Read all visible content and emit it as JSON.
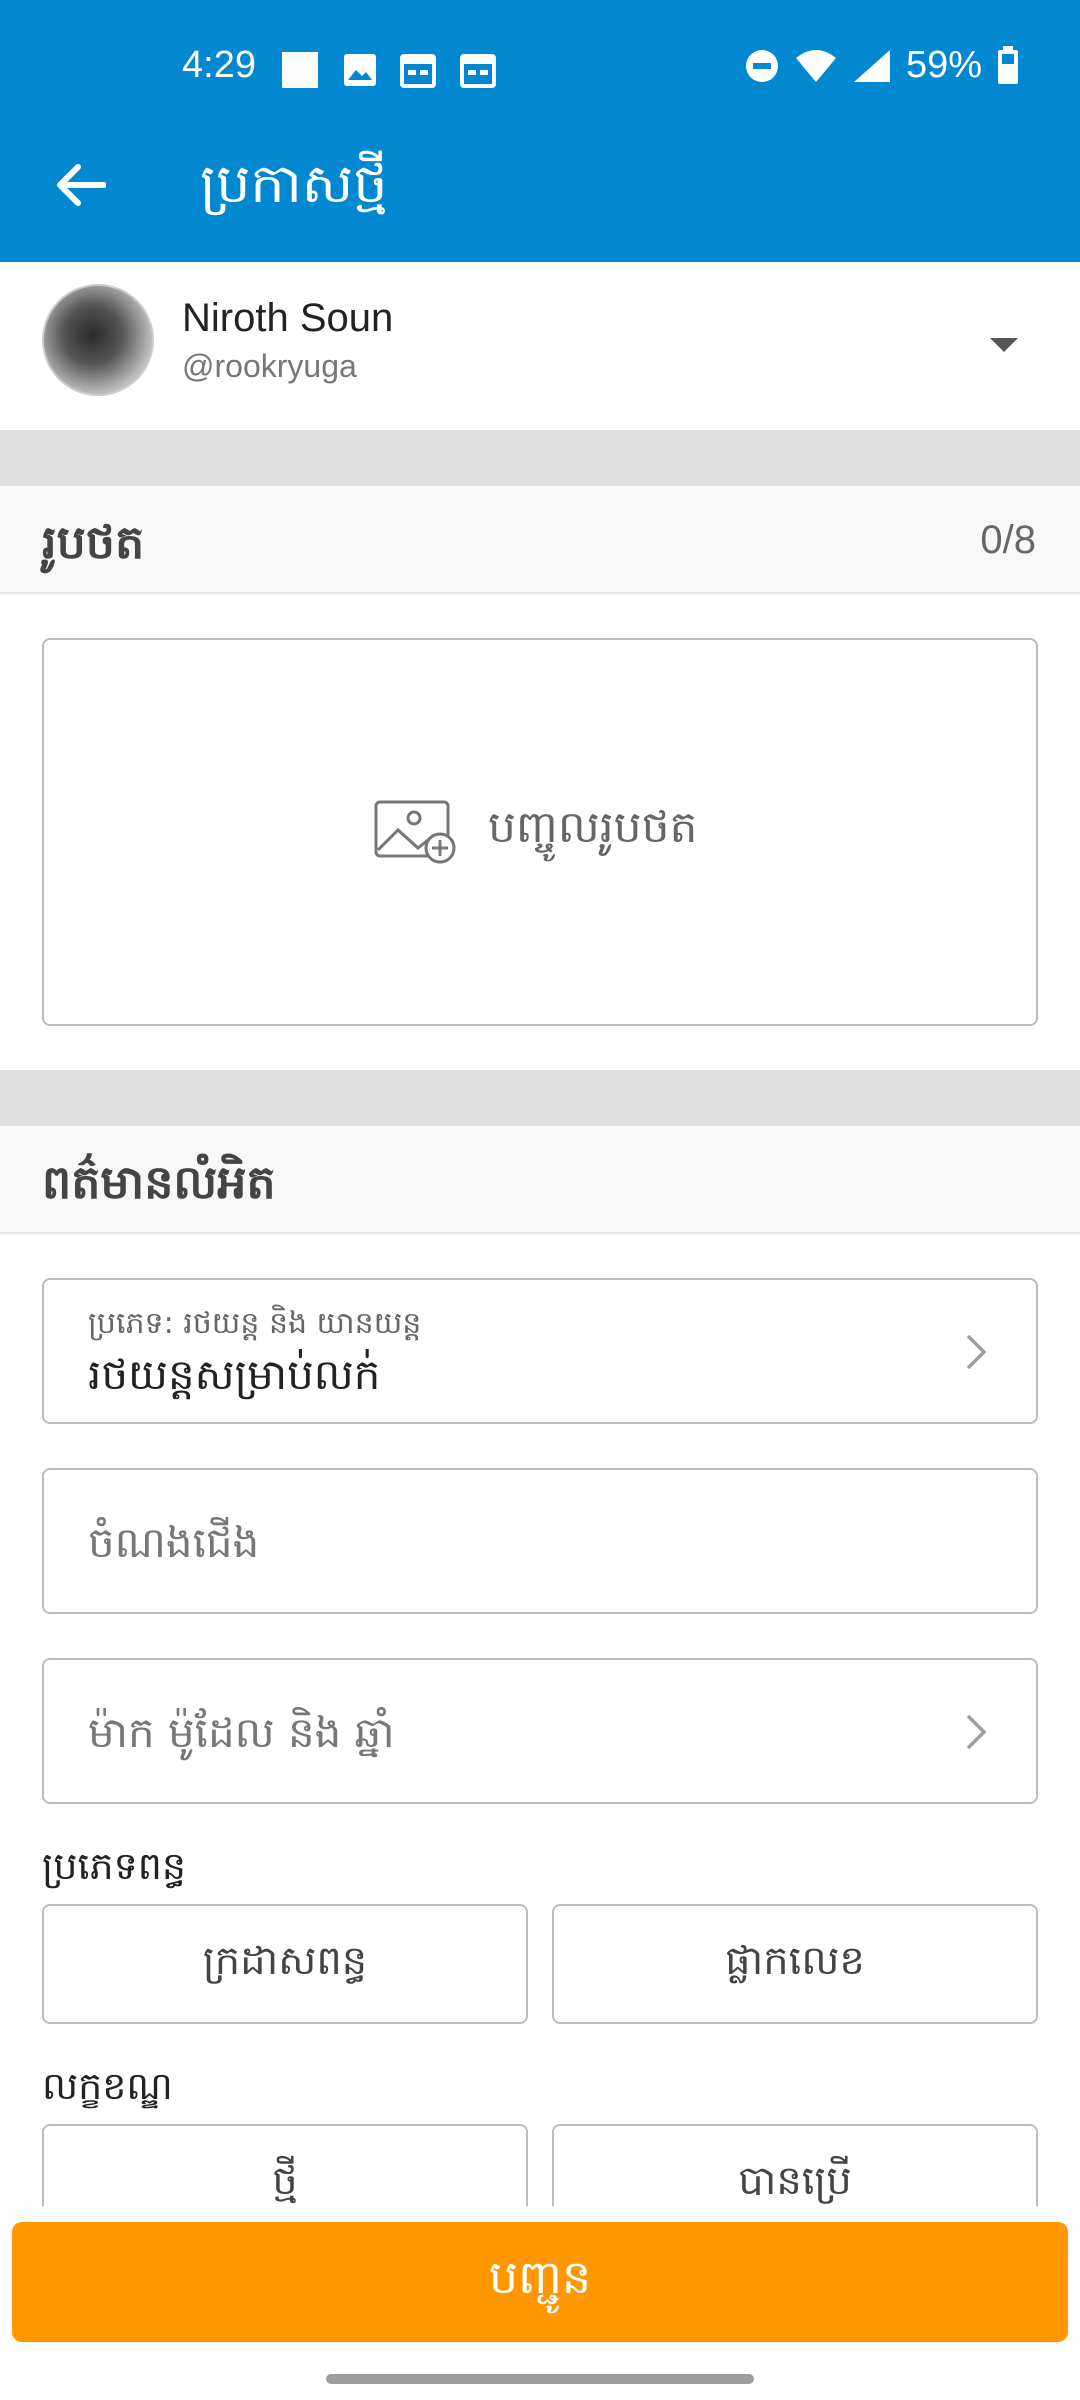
{
  "status_bar": {
    "time": "4:29",
    "battery": "59%"
  },
  "app_bar": {
    "title": "ប្រកាសថ្មី",
    "color": "#0288d1"
  },
  "profile": {
    "name": "Niroth Soun",
    "handle": "@rookryuga"
  },
  "photos": {
    "section_title": "រូបថត",
    "count": "0/8",
    "add_label": "បញ្ចូលរូបថត"
  },
  "details": {
    "section_title": "ពត៌មានលំអិត",
    "category": {
      "label": "ប្រភេទ: រថយន្ត និង យានយន្ត",
      "value": "រថយន្តសម្រាប់លក់"
    },
    "title_placeholder": "ចំណងជើង",
    "make_model_placeholder": "ម៉ាក ម៉ូដែល និង ឆ្នាំ",
    "plate_type": {
      "label": "ប្រភេទពន្ធ",
      "options": [
        "ក្រដាសពន្ធ",
        "ផ្លាកលេខ"
      ]
    },
    "condition": {
      "label": "លក្ខខណ្ឌ",
      "options": [
        "ថ្មី",
        "បានប្រើ"
      ]
    }
  },
  "submit": {
    "label": "បញ្ជូន",
    "color": "#ff9800"
  }
}
